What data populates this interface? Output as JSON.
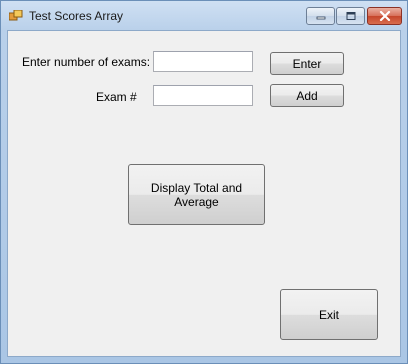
{
  "window": {
    "title": "Test Scores Array"
  },
  "form": {
    "num_exams_label": "Enter number of exams:",
    "num_exams_value": "",
    "enter_label": "Enter",
    "exam_label": "Exam #",
    "exam_value": "",
    "add_label": "Add",
    "display_label": "Display Total and Average",
    "exit_label": "Exit"
  },
  "colors": {
    "titlebar": "#b9d0ea",
    "client": "#f0f0f0",
    "close": "#c5452b"
  }
}
